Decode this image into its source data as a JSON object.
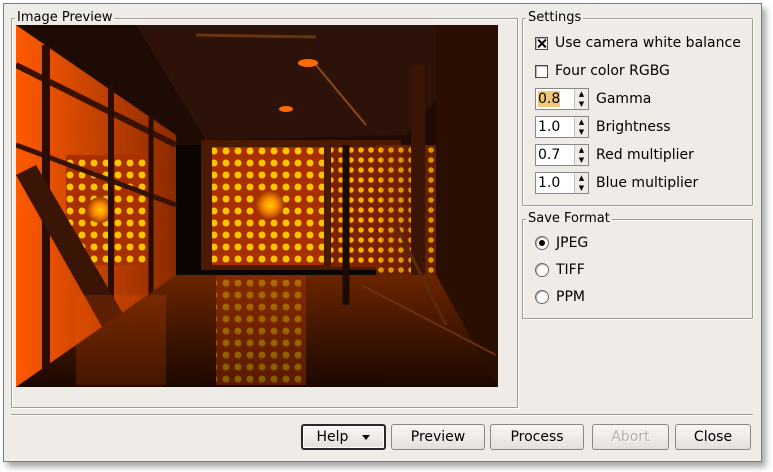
{
  "preview": {
    "title": "Image Preview"
  },
  "settings": {
    "title": "Settings",
    "camera_wb": {
      "label": "Use camera white balance",
      "checked": true
    },
    "four_color": {
      "label": "Four color RGBG",
      "checked": false
    },
    "gamma": {
      "value": "0.8",
      "label": "Gamma"
    },
    "brightness": {
      "value": "1.0",
      "label": "Brightness"
    },
    "red_multiplier": {
      "value": "0.7",
      "label": "Red multiplier"
    },
    "blue_multiplier": {
      "value": "1.0",
      "label": "Blue multiplier"
    }
  },
  "save_format": {
    "title": "Save Format",
    "options": [
      {
        "label": "JPEG",
        "selected": true
      },
      {
        "label": "TIFF",
        "selected": false
      },
      {
        "label": "PPM",
        "selected": false
      }
    ]
  },
  "buttons": {
    "help": {
      "label": "Help",
      "mnemonic": "H"
    },
    "preview": {
      "label": "Preview",
      "mnemonic": "P"
    },
    "process": {
      "label": "Process",
      "mnemonic": "r"
    },
    "abort": {
      "label": "Abort",
      "mnemonic": "A",
      "enabled": false
    },
    "close": {
      "label": "Close",
      "mnemonic": "C"
    }
  },
  "icons": {
    "spin_up": "chevron-up-icon",
    "spin_down": "chevron-down-icon",
    "help_menu": "dropdown-arrow-icon"
  },
  "colors": {
    "window_bg": "#efebe7",
    "selection": "#f0c878"
  }
}
